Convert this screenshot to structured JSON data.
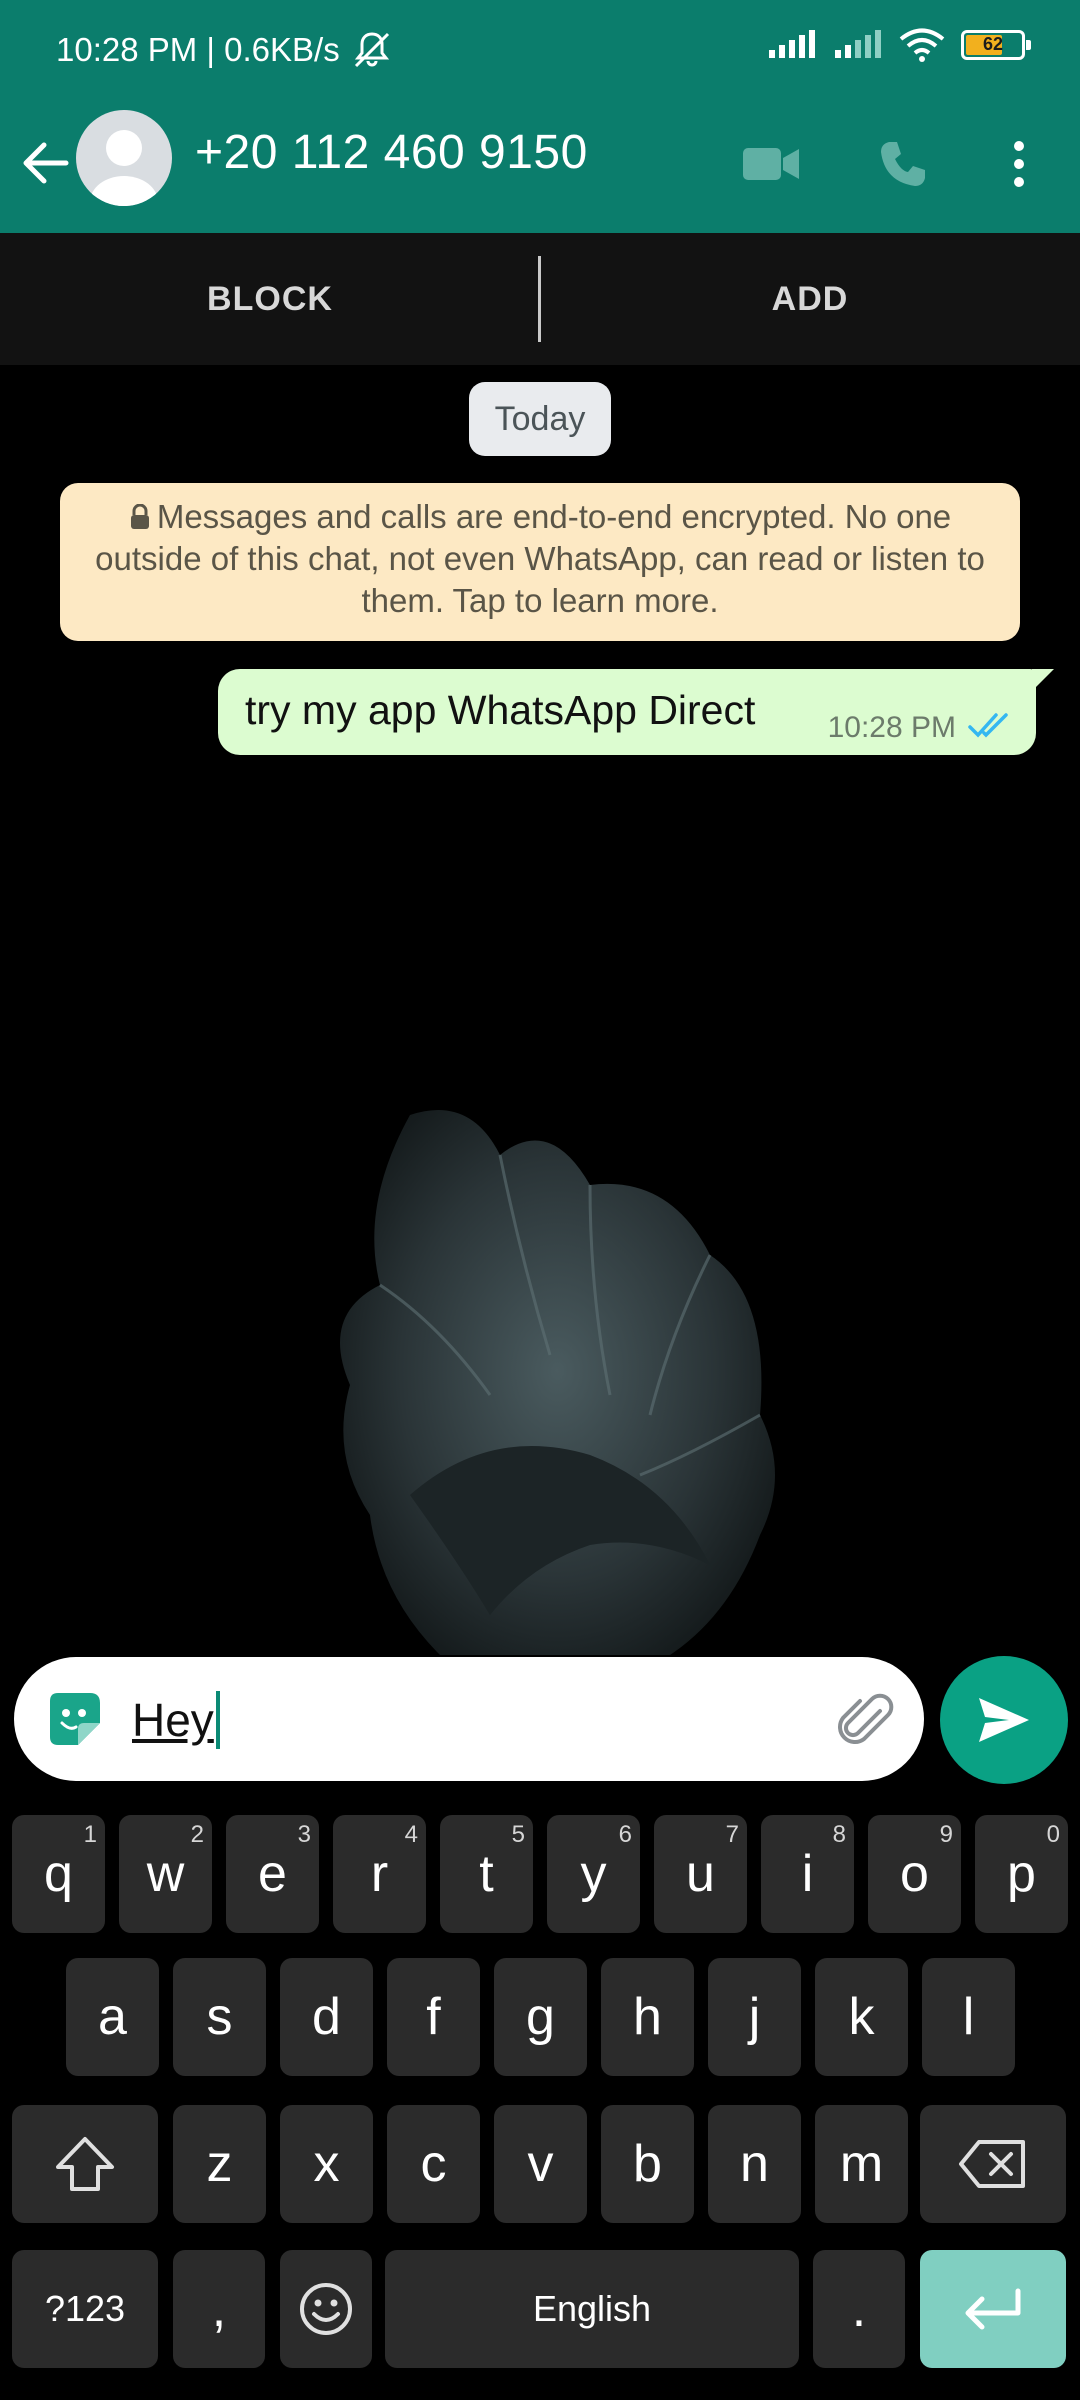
{
  "status_bar": {
    "time_speed": "10:28 PM | 0.6KB/s",
    "battery": "62"
  },
  "header": {
    "contact": "+20 112 460 9150"
  },
  "actions": {
    "block": "BLOCK",
    "add": "ADD"
  },
  "chat": {
    "date_chip": "Today",
    "encryption_notice": "Messages and calls are end-to-end encrypted. No one outside of this chat, not even WhatsApp, can read or listen to them. Tap to learn more.",
    "messages": [
      {
        "text": "try my app WhatsApp Direct",
        "time": "10:28 PM",
        "status": "read"
      }
    ]
  },
  "composer": {
    "value": "Hey"
  },
  "keyboard": {
    "row1": [
      {
        "k": "q",
        "h": "1"
      },
      {
        "k": "w",
        "h": "2"
      },
      {
        "k": "e",
        "h": "3"
      },
      {
        "k": "r",
        "h": "4"
      },
      {
        "k": "t",
        "h": "5"
      },
      {
        "k": "y",
        "h": "6"
      },
      {
        "k": "u",
        "h": "7"
      },
      {
        "k": "i",
        "h": "8"
      },
      {
        "k": "o",
        "h": "9"
      },
      {
        "k": "p",
        "h": "0"
      }
    ],
    "row2": [
      "a",
      "s",
      "d",
      "f",
      "g",
      "h",
      "j",
      "k",
      "l"
    ],
    "row3": [
      "z",
      "x",
      "c",
      "v",
      "b",
      "n",
      "m"
    ],
    "symbols": "?123",
    "comma": ",",
    "space": "English",
    "period": "."
  },
  "colors": {
    "header": "#0b7d6c",
    "accent": "#0aa184",
    "outgoing_bubble": "#dcfcd0",
    "notice": "#fde9c4"
  }
}
